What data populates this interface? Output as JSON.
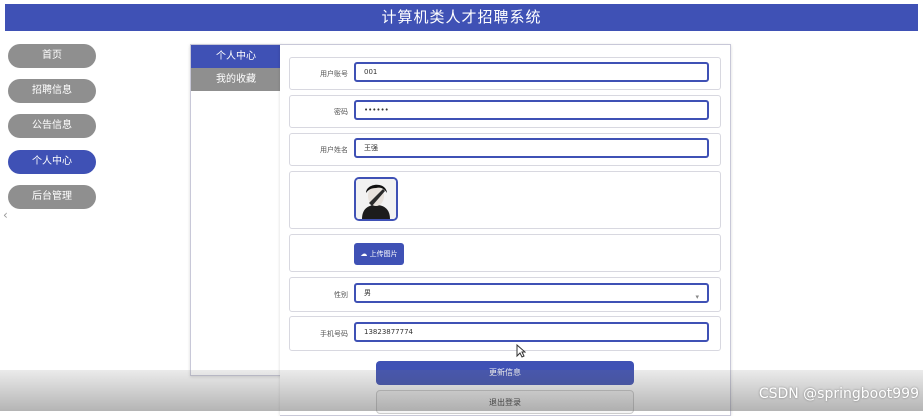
{
  "app": {
    "title": "计算机类人才招聘系统"
  },
  "sidebar": {
    "items": [
      {
        "label": "首页"
      },
      {
        "label": "招聘信息"
      },
      {
        "label": "公告信息"
      },
      {
        "label": "个人中心",
        "active": true
      },
      {
        "label": "后台管理"
      }
    ]
  },
  "tabs": [
    {
      "label": "个人中心",
      "active": true
    },
    {
      "label": "我的收藏"
    }
  ],
  "form": {
    "account": {
      "label": "用户账号",
      "value": "001"
    },
    "password": {
      "label": "密码",
      "value": "••••••"
    },
    "name": {
      "label": "用户姓名",
      "value": "王强"
    },
    "upload_label": "上传图片",
    "gender": {
      "label": "性别",
      "value": "男"
    },
    "phone": {
      "label": "手机号码",
      "value": "13823877774"
    },
    "update_label": "更新信息",
    "logout_label": "退出登录"
  },
  "watermark": "CSDN @springboot999",
  "colors": {
    "accent": "#3f51b5",
    "inactive": "#8f8f8f"
  }
}
